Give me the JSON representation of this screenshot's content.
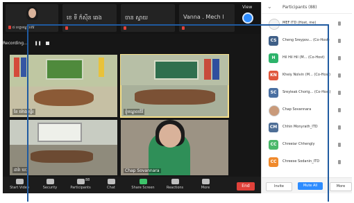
{
  "meeting": {
    "recording_label": "Recording...",
    "view_label": "View",
    "top_tiles": [
      {
        "name": "",
        "footer": "ជ ខេត្តមណ្ឌលគិរី"
      },
      {
        "name": "ខេ ទី ក៏ស៊ីន ឆេង",
        "footer": ""
      },
      {
        "name": "ចាន ស្វាយ",
        "footer": ""
      },
      {
        "name": "Vanna . Mech l",
        "footer": ""
      }
    ],
    "video_tiles": [
      {
        "name": "ខែ ម៉ោងមន្ទីរ",
        "active": false
      },
      {
        "name": "ខ្ញុំមណ្ឌលគិរី",
        "active": true
      },
      {
        "name": "ដារ៉ា ឃៈ",
        "active": false
      },
      {
        "name": "Chap Sovannara",
        "active": false
      }
    ],
    "toolbar": [
      {
        "label": "Start Video",
        "icon": "video-camera-icon"
      },
      {
        "label": "Security",
        "icon": "shield-icon"
      },
      {
        "label": "Participants",
        "icon": "participants-icon",
        "badge": "88"
      },
      {
        "label": "Chat",
        "icon": "chat-icon"
      },
      {
        "label": "Share Screen",
        "icon": "share-screen-icon"
      },
      {
        "label": "Reactions",
        "icon": "reactions-icon"
      },
      {
        "label": "More",
        "icon": "more-icon"
      }
    ],
    "end_label": "End"
  },
  "participants": {
    "title": "Participants (88)",
    "list": [
      {
        "initials": "",
        "name": "MEF ITD (Host, me)",
        "color": "#f2f2f2",
        "photo": true
      },
      {
        "initials": "CS",
        "name": "Cheng Sreypov... (Co-Host)",
        "color": "#3f5f87"
      },
      {
        "initials": "H",
        "name": "Hil Hil Hil (M... (Co-Host)",
        "color": "#2db36b"
      },
      {
        "initials": "KN",
        "name": "Kheiy Nolvin (M... (Co-Host)",
        "color": "#e0563b"
      },
      {
        "initials": "SC",
        "name": "Sreyleak Chorig... (Co-Host)",
        "color": "#4a6fa1"
      },
      {
        "initials": "",
        "name": "Chap Sovannara",
        "color": "#c99a7a",
        "photo": true
      },
      {
        "initials": "CM",
        "name": "Chhin Monyrath_ITD",
        "color": "#4e6e96"
      },
      {
        "initials": "CC",
        "name": "Chreeiar Chhengly",
        "color": "#4ab86a"
      },
      {
        "initials": "CC",
        "name": "Chreese Sodanin_ITD",
        "color": "#f08a2c"
      }
    ],
    "invite_label": "Invite",
    "mute_all_label": "Mute All",
    "more_label": "More"
  }
}
